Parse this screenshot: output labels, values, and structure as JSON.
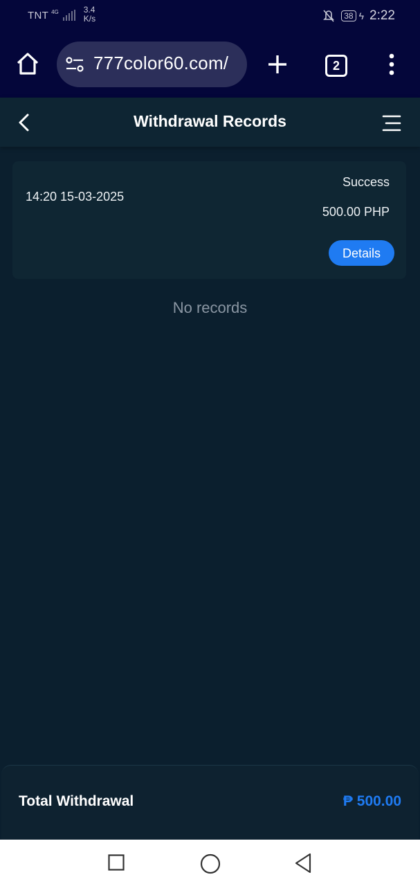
{
  "status_bar": {
    "carrier": "TNT",
    "network_type": "4G",
    "data_speed_value": "3.4",
    "data_speed_unit": "K/s",
    "battery_level": "38",
    "time": "2:22",
    "icons": [
      "signal-icon",
      "mute-icon",
      "battery-icon",
      "charging-bolt-icon"
    ]
  },
  "browser": {
    "url": "777color60.com/",
    "tab_count": "2",
    "icons": [
      "home-icon",
      "site-settings-icon",
      "plus-icon",
      "tab-switcher-icon",
      "more-vert-icon"
    ]
  },
  "header": {
    "title": "Withdrawal Records",
    "icons": [
      "chevron-left-icon",
      "hamburger-menu-icon"
    ]
  },
  "records": [
    {
      "datetime": "14:20 15-03-2025",
      "status": "Success",
      "amount": "500.00 PHP",
      "details_label": "Details"
    }
  ],
  "empty_message": "No records",
  "summary": {
    "label": "Total Withdrawal",
    "value": "₱ 500.00"
  },
  "nav_bar": {
    "icons": [
      "recent-apps-icon",
      "home-circle-icon",
      "back-triangle-icon"
    ]
  },
  "colors": {
    "status_bar_bg": "#04063a",
    "page_bg": "#0b1f2e",
    "card_bg": "#0f2633",
    "accent": "#1f7bf2",
    "muted_text": "#8a96a3"
  }
}
